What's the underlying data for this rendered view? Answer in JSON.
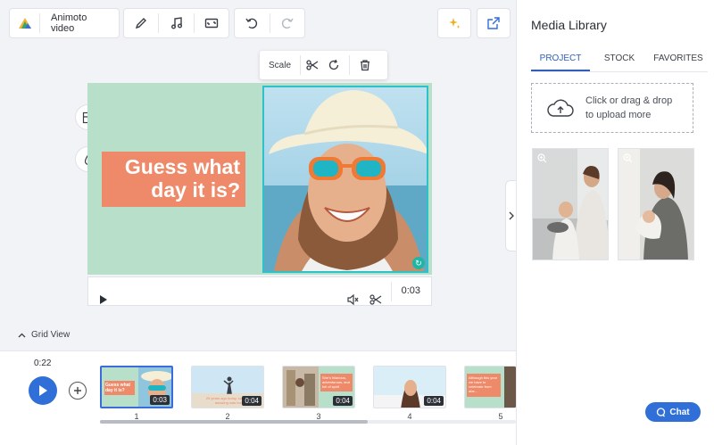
{
  "toolbar": {
    "brand_label": "Animoto video",
    "icons": [
      "animoto-logo-icon",
      "pen-icon",
      "music-icon",
      "aspect-ratio-icon",
      "undo-icon",
      "redo-icon",
      "magic-sparkle-icon",
      "share-export-icon"
    ]
  },
  "float_toolbar": {
    "scale_label": "Scale"
  },
  "canvas": {
    "caption": "Guess what day it is?"
  },
  "player": {
    "time": "0:03"
  },
  "grid_view": {
    "label": "Grid View"
  },
  "timeline": {
    "total_time": "0:22",
    "clips": [
      {
        "num": "1",
        "dur": "0:03",
        "selected": true,
        "text": "Guess what day it is?"
      },
      {
        "num": "2",
        "dur": "0:04",
        "selected": false,
        "text": "25 years ago today, someone amazing was born"
      },
      {
        "num": "3",
        "dur": "0:04",
        "selected": false,
        "text": "She's hilarious, adventurous, and full of spirit"
      },
      {
        "num": "4",
        "dur": "0:04",
        "selected": false,
        "text": ""
      },
      {
        "num": "5",
        "dur": "",
        "selected": false,
        "text": "Although this year we have to celebrate from afar..."
      }
    ]
  },
  "panel": {
    "title": "Media Library",
    "tabs": [
      "PROJECT",
      "STOCK",
      "FAVORITES"
    ],
    "active_tab": "PROJECT",
    "upload_line1": "Click or drag & drop",
    "upload_line2": "to upload more",
    "chat_label": "Chat"
  },
  "colors": {
    "accent": "#2f6fd7",
    "canvas_bg": "#b7dfc9",
    "caption_bg": "#ee8a69",
    "selection": "#2dc1c9"
  }
}
